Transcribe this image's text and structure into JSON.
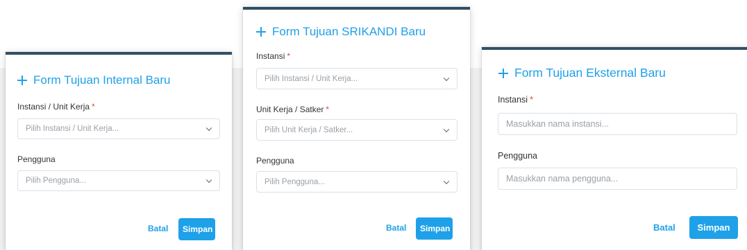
{
  "internal_form": {
    "title": "Form Tujuan Internal Baru",
    "instansi_label": "Instansi / Unit Kerja",
    "instansi_placeholder": "Pilih Instansi / Unit Kerja...",
    "pengguna_label": "Pengguna",
    "pengguna_placeholder": "Pilih Pengguna...",
    "cancel_label": "Batal",
    "save_label": "Simpan"
  },
  "srikandi_form": {
    "title": "Form Tujuan SRIKANDI Baru",
    "instansi_label": "Instansi",
    "instansi_placeholder": "Pilih Instansi / Unit Kerja...",
    "unit_label": "Unit Kerja / Satker",
    "unit_placeholder": "Pilih Unit Kerja / Satker...",
    "pengguna_label": "Pengguna",
    "pengguna_placeholder": "Pilih Pengguna...",
    "cancel_label": "Batal",
    "save_label": "Simpan"
  },
  "external_form": {
    "title": "Form Tujuan Eksternal Baru",
    "instansi_label": "Instansi",
    "instansi_placeholder": "Masukkan nama instansi...",
    "pengguna_label": "Pengguna",
    "pengguna_placeholder": "Masukkan nama pengguna...",
    "cancel_label": "Batal",
    "save_label": "Simpan"
  },
  "required_marker": "*",
  "icons": {
    "add": "plus-icon",
    "dropdown": "chevron-down-icon"
  },
  "colors": {
    "accent": "#1ea1e8",
    "required": "#e0463d",
    "backdrop": "#2f4f63"
  }
}
